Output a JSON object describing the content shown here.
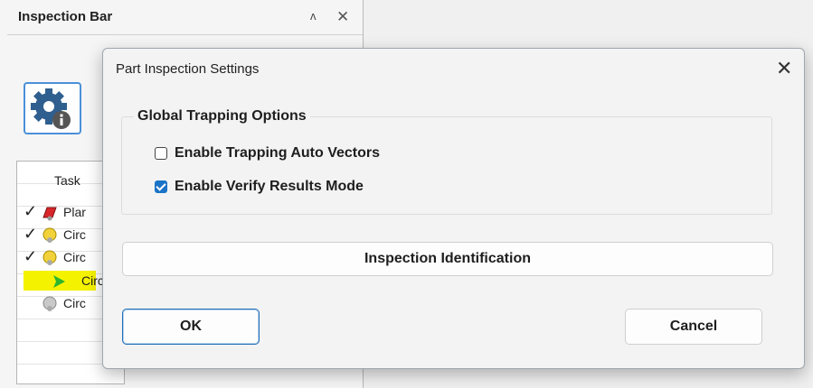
{
  "panel": {
    "title": "Inspection Bar",
    "pin_icon": "pin-icon",
    "close_icon": "close-icon",
    "settings_icon": "gear-info-icon",
    "task_header": "Task",
    "tasks": [
      {
        "checked": true,
        "icon": "plane-icon",
        "label": "Plar",
        "active": false
      },
      {
        "checked": true,
        "icon": "circle-icon",
        "label": "Circ",
        "active": false
      },
      {
        "checked": true,
        "icon": "circle-icon",
        "label": "Circ",
        "active": false
      },
      {
        "checked": false,
        "icon": "arrow-icon",
        "label": "Circ",
        "active": true
      },
      {
        "checked": false,
        "icon": "circle-gray-icon",
        "label": "Circ",
        "active": false
      }
    ]
  },
  "dialog": {
    "title": "Part Inspection Settings",
    "group_label": "Global Trapping Options",
    "option_auto_vectors": {
      "label": "Enable Trapping Auto Vectors",
      "checked": false
    },
    "option_verify_results": {
      "label": "Enable Verify Results Mode",
      "checked": true
    },
    "identification_button": "Inspection Identification",
    "ok_button": "OK",
    "cancel_button": "Cancel"
  },
  "colors": {
    "accent": "#1a73c7",
    "active_task_highlight": "#f5f200"
  }
}
